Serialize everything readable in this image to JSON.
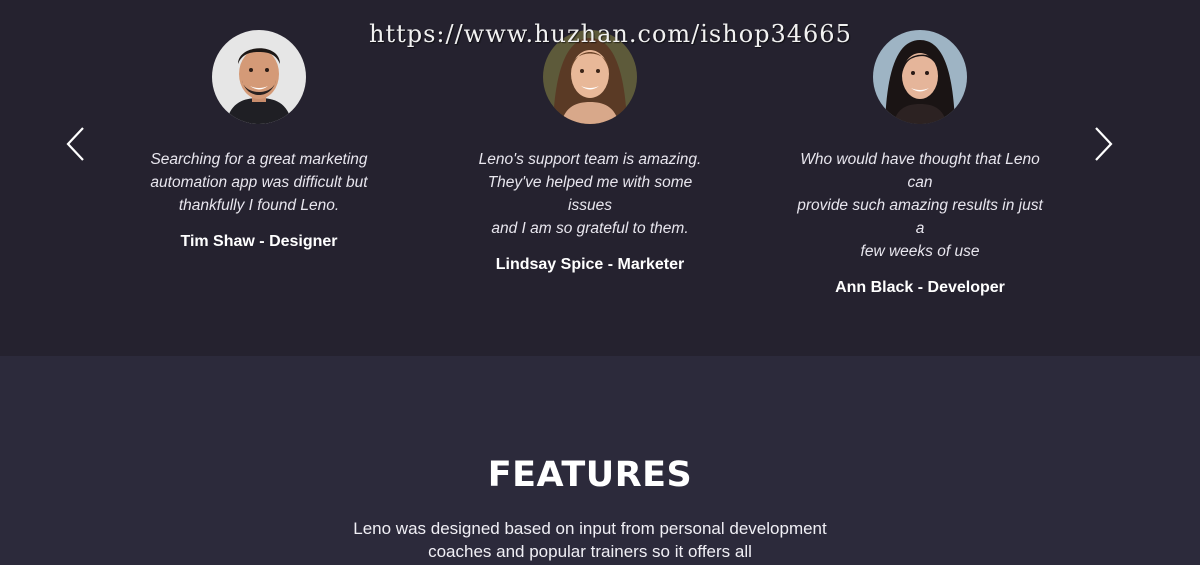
{
  "watermark": "https://www.huzhan.com/ishop34665",
  "testimonials": [
    {
      "quote_lines": [
        "Searching for a great marketing",
        "automation app was difficult but",
        "thankfully I found Leno."
      ],
      "author": "Tim Shaw - Designer"
    },
    {
      "quote_lines": [
        "Leno's support team is amazing.",
        "They've helped me with some issues",
        "and I am so grateful to them."
      ],
      "author": "Lindsay Spice - Marketer"
    },
    {
      "quote_lines": [
        "Who would have thought that Leno can",
        "provide such amazing results in just a",
        "few weeks of use"
      ],
      "author": "Ann Black - Developer"
    }
  ],
  "slider": {
    "prev_icon": "chevron-left-icon",
    "next_icon": "chevron-right-icon"
  },
  "features": {
    "title": "FEATURES",
    "description_lines": [
      "Leno was designed based on input from personal development",
      "coaches and popular trainers so it offers all"
    ]
  },
  "colors": {
    "testimonials_bg": "#25222f",
    "features_bg": "#2c2a3b",
    "text": "#ffffff"
  }
}
